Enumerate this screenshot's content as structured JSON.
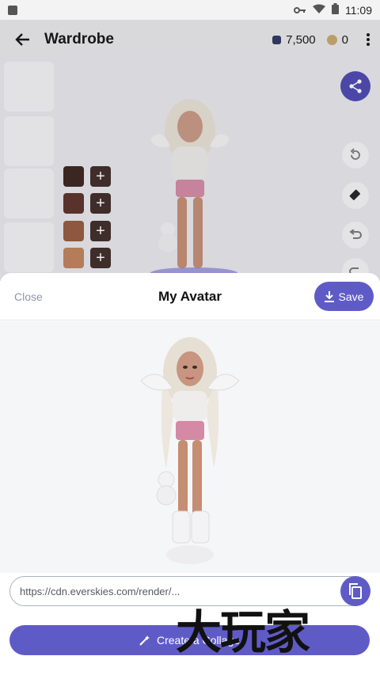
{
  "status_bar": {
    "time": "11:09"
  },
  "app_bar": {
    "title": "Wardrobe",
    "gems": "7,500",
    "coins": "0"
  },
  "wardrobe": {
    "swatch_colors": [
      "#3a221c",
      "#5a3026",
      "#95593e",
      "#c0825a"
    ],
    "plus_label": "+"
  },
  "sheet": {
    "close_label": "Close",
    "title": "My Avatar",
    "save_label": "Save",
    "url_value": "https://cdn.everskies.com/render/...",
    "collage_label": "Create a Collage"
  },
  "watermark": {
    "text": "大玩家"
  },
  "colors": {
    "accent": "#5f5bc6",
    "share": "#4b47b0"
  }
}
